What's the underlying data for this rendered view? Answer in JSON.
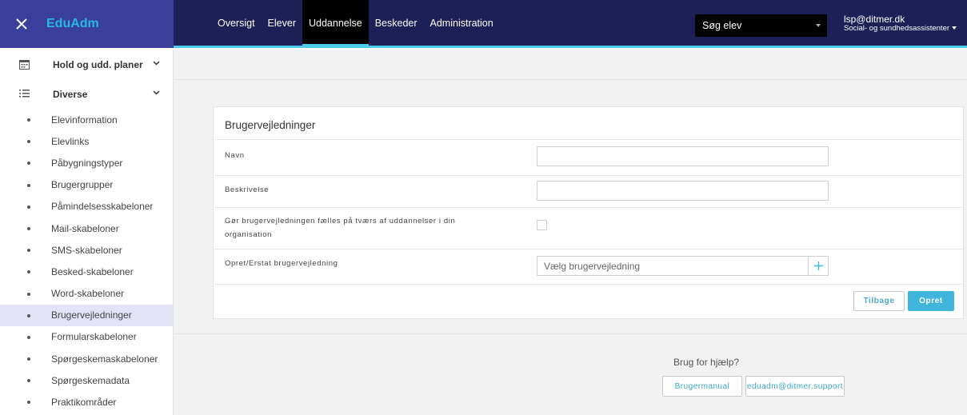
{
  "app": {
    "brand": "EduAdm"
  },
  "nav": {
    "items": [
      {
        "label": "Oversigt"
      },
      {
        "label": "Elever"
      },
      {
        "label": "Uddannelse"
      },
      {
        "label": "Beskeder"
      },
      {
        "label": "Administration"
      }
    ],
    "active": "Uddannelse"
  },
  "search": {
    "label": "Søg elev"
  },
  "user": {
    "email": "lsp@ditmer.dk",
    "role": "Social- og sundhedsassistenter"
  },
  "sidebar": {
    "groups": [
      {
        "label": "Hold og udd. planer",
        "icon": "calendar-icon"
      },
      {
        "label": "Diverse",
        "icon": "list-icon"
      }
    ],
    "items": [
      {
        "label": "Elevinformation"
      },
      {
        "label": "Elevlinks"
      },
      {
        "label": "Påbygningstyper"
      },
      {
        "label": "Brugergrupper"
      },
      {
        "label": "Påmindelsesskabeloner"
      },
      {
        "label": "Mail-skabeloner"
      },
      {
        "label": "SMS-skabeloner"
      },
      {
        "label": "Besked-skabeloner"
      },
      {
        "label": "Word-skabeloner"
      },
      {
        "label": "Brugervejledninger"
      },
      {
        "label": "Formularskabeloner"
      },
      {
        "label": "Spørgeskemaskabeloner"
      },
      {
        "label": "Spørgeskemadata"
      },
      {
        "label": "Praktikområder"
      }
    ],
    "active": "Brugervejledninger"
  },
  "form": {
    "title": "Brugervejledninger",
    "name_label": "Navn",
    "name_value": "",
    "description_label": "Beskrivelse",
    "description_value": "",
    "shared_label": "Gør brugervejledningen fælles på tværs af uddannelser i din organisation",
    "shared_checked": false,
    "file_label": "Opret/Erstat brugervejledning",
    "file_placeholder": "Vælg brugervejledning",
    "back_button": "Tilbage",
    "create_button": "Opret"
  },
  "help": {
    "text": "Brug for hjælp?",
    "manual_button": "Brugermanual",
    "support_button": "eduadm@ditmer.support"
  },
  "colors": {
    "brand_bar": "#3a3f9c",
    "navbar": "#1d2057",
    "accent": "#4dcbef",
    "primary_button": "#3fb5dc"
  }
}
